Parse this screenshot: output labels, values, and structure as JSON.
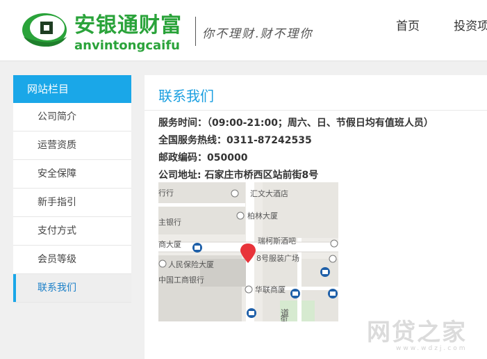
{
  "brand": {
    "name_cn": "安银通财富",
    "name_en": "anvintongcaifu",
    "slogan": "你不理财.财不理你",
    "accent": "#2aa33a"
  },
  "nav": {
    "items": [
      {
        "label": "首页"
      },
      {
        "label": "投资项"
      }
    ]
  },
  "sidebar": {
    "title": "网站栏目",
    "accent": "#1aa7e8",
    "items": [
      {
        "label": "公司简介"
      },
      {
        "label": "运营资质"
      },
      {
        "label": "安全保障"
      },
      {
        "label": "新手指引"
      },
      {
        "label": "支付方式"
      },
      {
        "label": "会员等级"
      },
      {
        "label": "联系我们",
        "active": true
      }
    ]
  },
  "contact": {
    "title": "联系我们",
    "hours": "服务时间：（09:00-21:00；周六、日、节假日均有值班人员）",
    "hotline": "全国服务热线：0311-87242535",
    "postcode": "邮政编码：050000",
    "address": "公司地址: 石家庄市桥西区站前街8号"
  },
  "map": {
    "labels": {
      "l1": "行行",
      "l2": "汇文大酒店",
      "l3": "柏林大厦",
      "l4": "主银行",
      "l5": "瑞柯斯酒吧",
      "l6": "商大厦",
      "l7": "8号服装广场",
      "l8": "人民保险大厦",
      "l9": "中国工商银行",
      "l10": "华联商厦",
      "l11": "道",
      "l12": "街"
    }
  },
  "watermark": {
    "text": "网贷之家",
    "sub": "www.wdzj.com"
  }
}
